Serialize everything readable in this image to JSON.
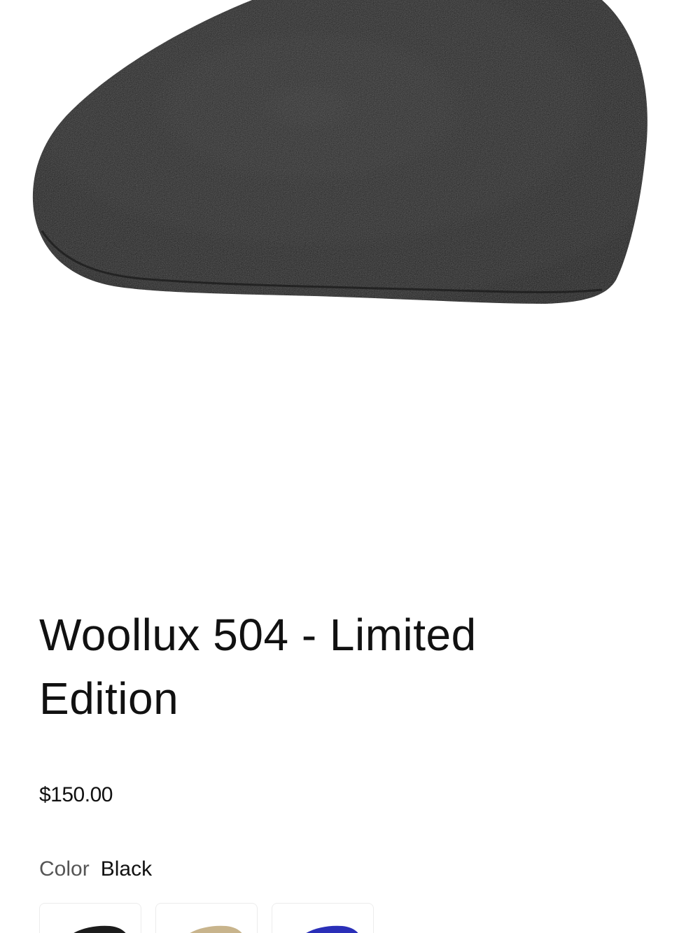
{
  "product": {
    "title": "Woollux 504 - Limited Edition",
    "price": "$150.00",
    "color_label": "Color",
    "color_value": "Black"
  },
  "image": {
    "icon": "flat-cap-black-image",
    "cap_color": "#1f1f1f"
  },
  "swatches": [
    {
      "name": "Black",
      "color": "#1c1c1c"
    },
    {
      "name": "Tan",
      "color": "#c8b48c"
    },
    {
      "name": "Blue",
      "color": "#2a2fb8"
    }
  ]
}
